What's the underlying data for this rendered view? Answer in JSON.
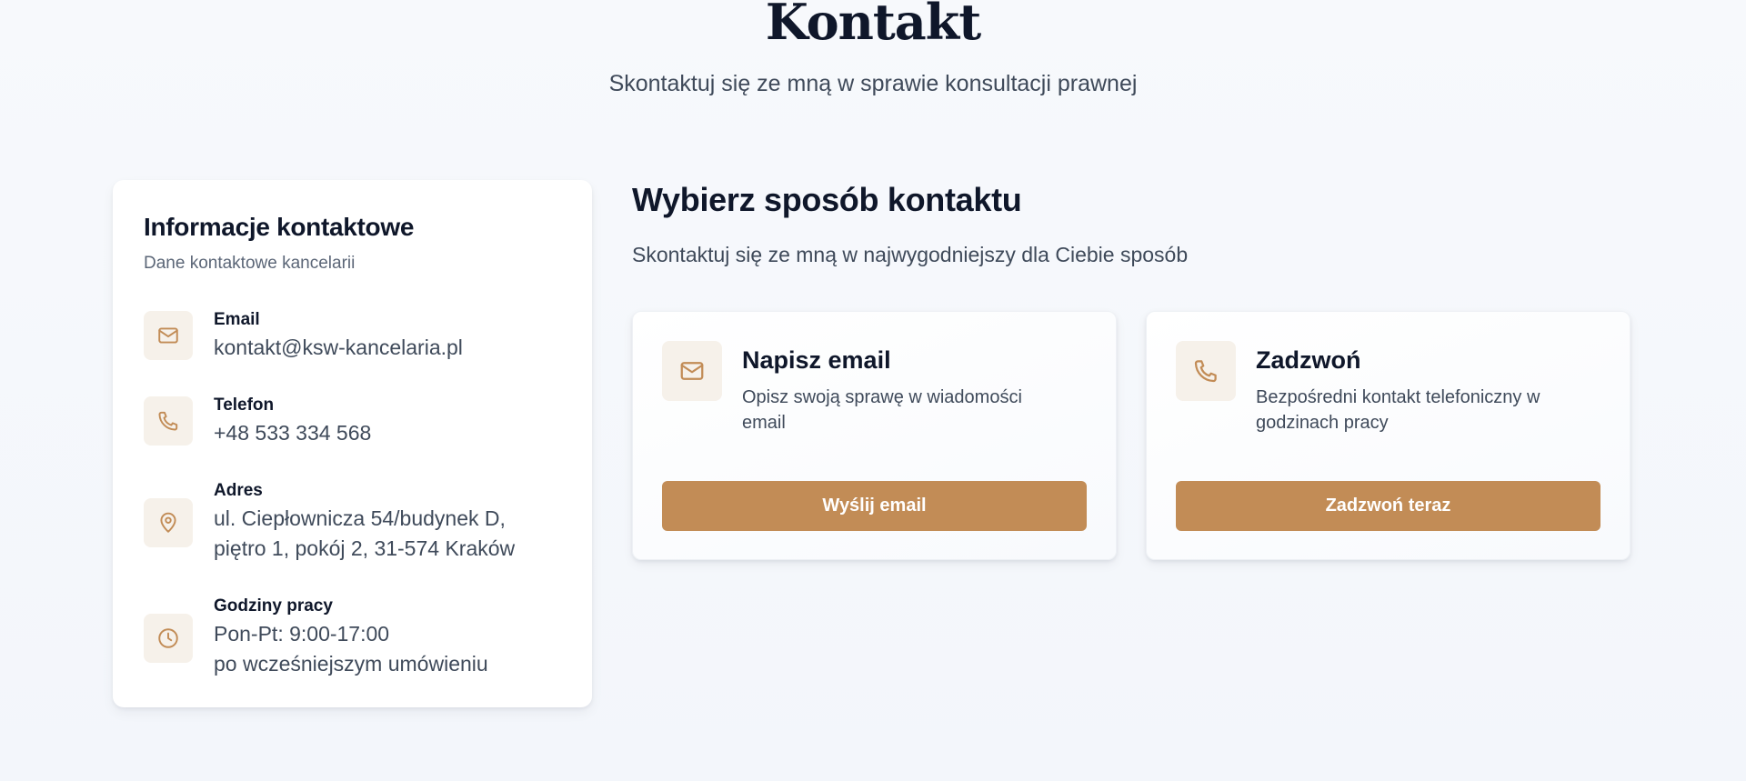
{
  "header": {
    "title": "Kontakt",
    "subtitle": "Skontaktuj się ze mną w sprawie konsultacji prawnej"
  },
  "info_card": {
    "title": "Informacje kontaktowe",
    "description": "Dane kontaktowe kancelarii",
    "items": [
      {
        "icon": "mail-icon",
        "label": "Email",
        "value": "kontakt@ksw-kancelaria.pl"
      },
      {
        "icon": "phone-icon",
        "label": "Telefon",
        "value": "+48 533 334 568"
      },
      {
        "icon": "map-pin-icon",
        "label": "Adres",
        "value_line1": "ul. Ciepłownicza 54/budynek D,",
        "value_line2": "piętro 1, pokój 2, 31-574 Kraków"
      },
      {
        "icon": "clock-icon",
        "label": "Godziny pracy",
        "value_line1": "Pon-Pt: 9:00-17:00",
        "value_line2": "po wcześniejszym umówieniu"
      }
    ]
  },
  "contact_methods": {
    "title": "Wybierz sposób kontaktu",
    "subtitle": "Skontaktuj się ze mną w najwygodniejszy dla Ciebie sposób",
    "cards": [
      {
        "icon": "mail-icon",
        "title": "Napisz email",
        "description": "Opisz swoją sprawę w wiadomości email",
        "button_label": "Wyślij email"
      },
      {
        "icon": "phone-icon",
        "title": "Zadzwoń",
        "description": "Bezpośredni kontakt telefoniczny w godzinach pracy",
        "button_label": "Zadzwoń teraz"
      }
    ]
  },
  "colors": {
    "accent": "#c28c56",
    "icon_background": "#f6f1ea",
    "heading": "#0f172a",
    "body_text": "#3f4a5a"
  }
}
